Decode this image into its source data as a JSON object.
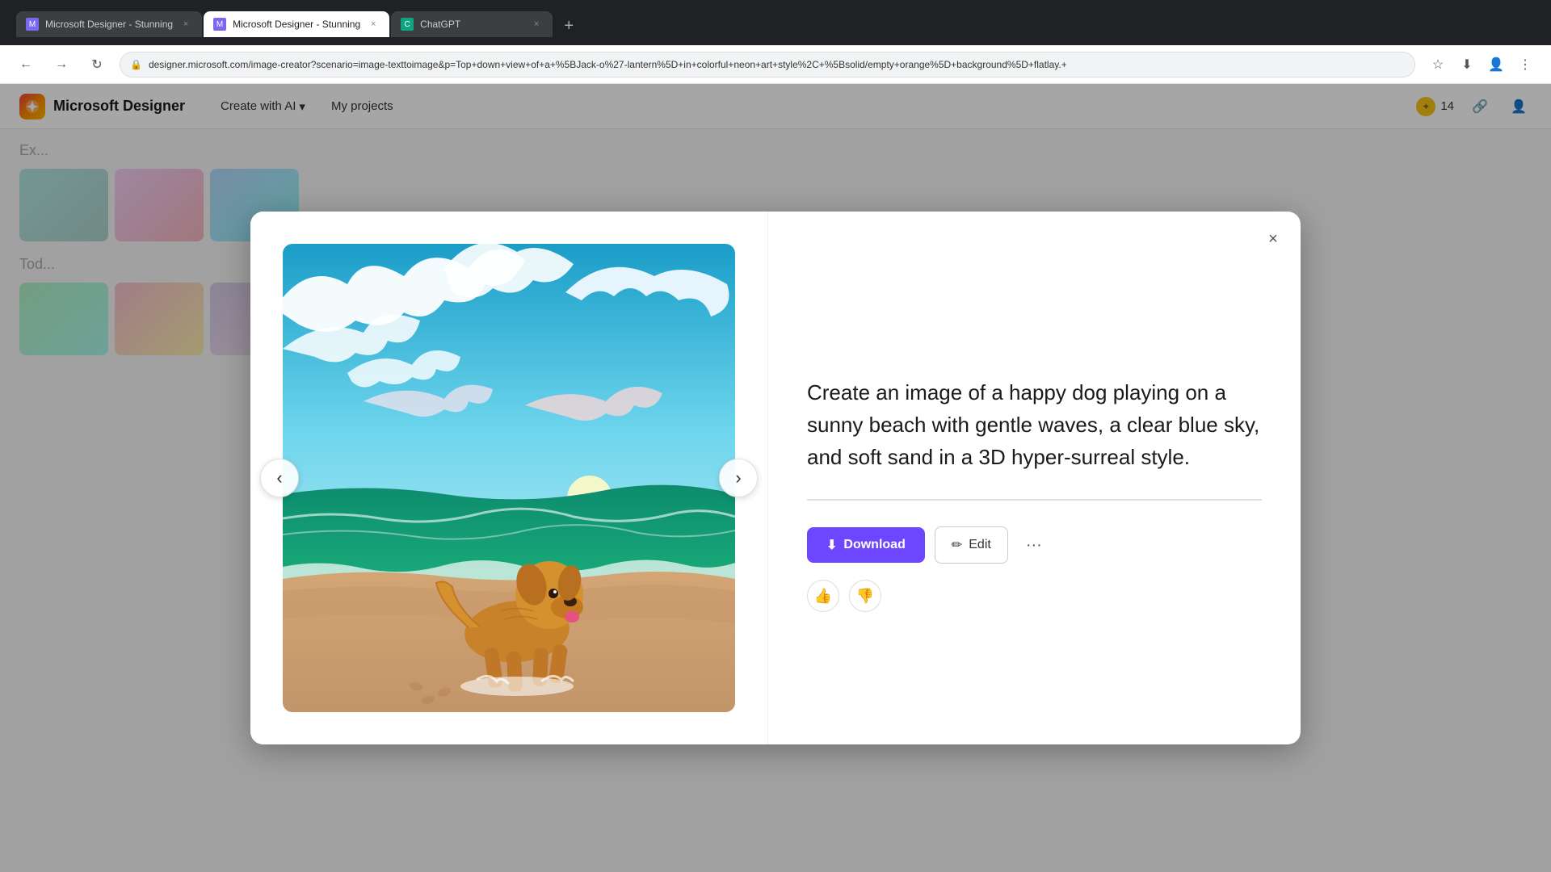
{
  "browser": {
    "tabs": [
      {
        "id": "tab1",
        "title": "Microsoft Designer - Stunning",
        "favicon": "designer",
        "active": false
      },
      {
        "id": "tab2",
        "title": "Microsoft Designer - Stunning",
        "favicon": "designer",
        "active": true
      },
      {
        "id": "tab3",
        "title": "ChatGPT",
        "favicon": "chatgpt",
        "active": false
      }
    ],
    "address": "designer.microsoft.com/image-creator?scenario=image-texttoimage&p=Top+down+view+of+a+%5BJack-o%27-lantern%5D+in+colorful+neon+art+style%2C+%5Bsolid/empty+orange%5D+background%5D+flatlay.+"
  },
  "app": {
    "name": "Microsoft Designer",
    "logo_text": "✦",
    "nav": {
      "create_with_ai": "Create with AI",
      "my_projects": "My projects"
    },
    "header": {
      "coins_count": "14"
    }
  },
  "modal": {
    "close_label": "×",
    "prompt_text": "Create an image of a happy dog playing on a sunny beach with gentle waves, a clear blue sky, and soft sand in a 3D hyper-surreal style.",
    "actions": {
      "download": "Download",
      "edit": "Edit",
      "more": "···"
    },
    "feedback": {
      "thumbs_up": "👍",
      "thumbs_down": "👎"
    },
    "nav": {
      "prev": "‹",
      "next": "›"
    }
  },
  "background": {
    "section_today": "Tod...",
    "section_explore": "Ex..."
  }
}
